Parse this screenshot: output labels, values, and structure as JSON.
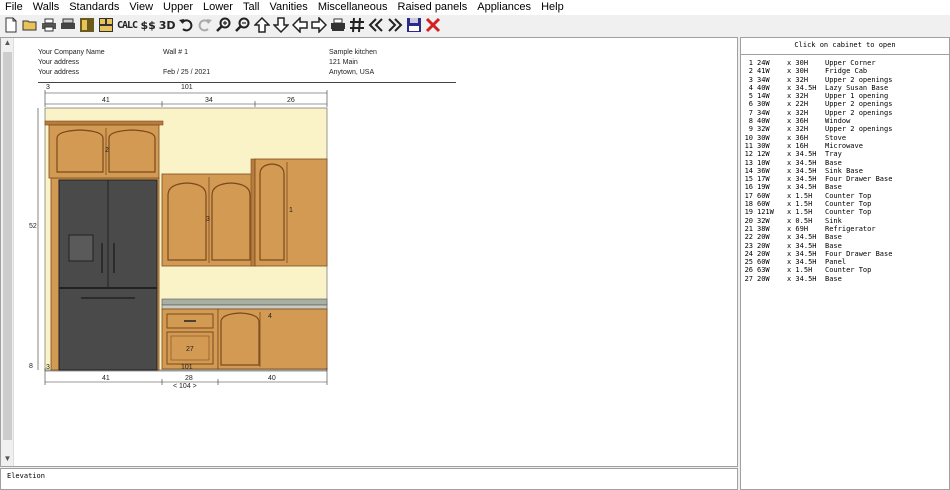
{
  "menu": [
    "File",
    "Walls",
    "Standards",
    "View",
    "Upper",
    "Lower",
    "Tall",
    "Vanities",
    "Miscellaneous",
    "Raised panels",
    "Appliances",
    "Help"
  ],
  "toolbar": {
    "calc_label": "CALC",
    "cost_label": "$$",
    "view3d_label": "3D",
    "icons": [
      "new-file-icon",
      "open-folder-icon",
      "print-icon",
      "print-preview-icon",
      "layout-icon",
      "grid-layout-icon",
      "calc-icon",
      "cost-icon",
      "3d-view-icon",
      "undo-icon",
      "redo-icon",
      "zoom-in-icon",
      "zoom-out-icon",
      "arrow-up-icon",
      "arrow-down-icon",
      "arrow-left-icon",
      "arrow-right-icon",
      "printer-icon",
      "hash-icon",
      "rewind-icon",
      "fast-forward-icon",
      "save-icon",
      "close-icon"
    ]
  },
  "header": {
    "company": "Your Company Name",
    "address1": "Your address",
    "address2": "Your address",
    "wall": "Wall # 1",
    "date": "Feb / 25 / 2021",
    "project": "Sample kitchen",
    "street": "121 Main",
    "city": "Anytown, USA"
  },
  "elevation": {
    "top_dims": {
      "overall_start": "3",
      "overall": "101",
      "segments": [
        "41",
        "34",
        "26"
      ]
    },
    "bottom_dims": {
      "overall_start": "3",
      "overall": "101",
      "segments": [
        "41",
        "28",
        "40"
      ],
      "total": "< 104 >"
    },
    "side_dims": {
      "height": "52",
      "base_offset": "8"
    },
    "cabinet_tags": [
      "2",
      "3",
      "1",
      "27",
      "4"
    ]
  },
  "colors": {
    "wood": "#d39a53",
    "wood_dark": "#7a4a1d",
    "wall": "#fbf3c8",
    "fridge": "#4a4a4a",
    "counter": "#a7b0a2"
  },
  "list": {
    "header": "Click on cabinet to open",
    "items": [
      {
        "id": "1",
        "w": "24W",
        "h": "x 30H",
        "desc": "Upper Corner"
      },
      {
        "id": "2",
        "w": "41W",
        "h": "x 30H",
        "desc": "Fridge Cab"
      },
      {
        "id": "3",
        "w": "34W",
        "h": "x 32H",
        "desc": "Upper 2 openings"
      },
      {
        "id": "4",
        "w": "40W",
        "h": "x 34.5H",
        "desc": "Lazy Susan Base"
      },
      {
        "id": "5",
        "w": "14W",
        "h": "x 32H",
        "desc": "Upper 1 opening"
      },
      {
        "id": "6",
        "w": "30W",
        "h": "x 22H",
        "desc": "Upper 2 openings"
      },
      {
        "id": "7",
        "w": "34W",
        "h": "x 32H",
        "desc": "Upper 2 openings"
      },
      {
        "id": "8",
        "w": "40W",
        "h": "x 36H",
        "desc": "Window"
      },
      {
        "id": "9",
        "w": "32W",
        "h": "x 32H",
        "desc": "Upper 2 openings"
      },
      {
        "id": "10",
        "w": "30W",
        "h": "x 36H",
        "desc": "Stove"
      },
      {
        "id": "11",
        "w": "30W",
        "h": "x 16H",
        "desc": "Microwave"
      },
      {
        "id": "12",
        "w": "12W",
        "h": "x 34.5H",
        "desc": "Tray"
      },
      {
        "id": "13",
        "w": "10W",
        "h": "x 34.5H",
        "desc": "Base"
      },
      {
        "id": "14",
        "w": "36W",
        "h": "x 34.5H",
        "desc": "Sink Base"
      },
      {
        "id": "15",
        "w": "17W",
        "h": "x 34.5H",
        "desc": "Four Drawer Base"
      },
      {
        "id": "16",
        "w": "19W",
        "h": "x 34.5H",
        "desc": "Base"
      },
      {
        "id": "17",
        "w": "60W",
        "h": "x 1.5H",
        "desc": "Counter Top"
      },
      {
        "id": "18",
        "w": "60W",
        "h": "x 1.5H",
        "desc": "Counter Top"
      },
      {
        "id": "19",
        "w": "121W",
        "h": "x 1.5H",
        "desc": "Counter Top"
      },
      {
        "id": "20",
        "w": "32W",
        "h": "x 0.5H",
        "desc": "Sink"
      },
      {
        "id": "21",
        "w": "38W",
        "h": "x 69H",
        "desc": "Refrigerator"
      },
      {
        "id": "22",
        "w": "20W",
        "h": "x 34.5H",
        "desc": "Base"
      },
      {
        "id": "23",
        "w": "20W",
        "h": "x 34.5H",
        "desc": "Base"
      },
      {
        "id": "24",
        "w": "20W",
        "h": "x 34.5H",
        "desc": "Four Drawer Base"
      },
      {
        "id": "25",
        "w": "60W",
        "h": "x 34.5H",
        "desc": "Panel"
      },
      {
        "id": "26",
        "w": "63W",
        "h": "x 1.5H",
        "desc": "Counter Top"
      },
      {
        "id": "27",
        "w": "20W",
        "h": "x 34.5H",
        "desc": "Base"
      }
    ]
  },
  "status": {
    "text": "Elevation"
  }
}
